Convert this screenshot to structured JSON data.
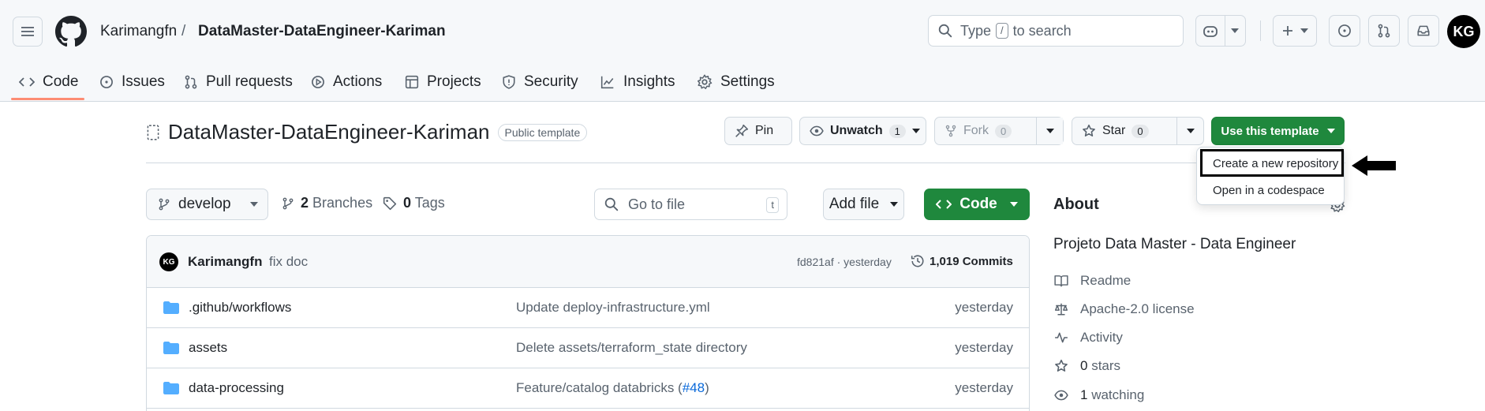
{
  "header": {
    "owner": "Karimangfn",
    "separator": "/",
    "repo": "DataMaster-DataEngineer-Kariman",
    "search_prefix": "Type",
    "search_key": "/",
    "search_suffix": "to search",
    "avatar_initials": "KG"
  },
  "nav": {
    "tabs": [
      {
        "label": "Code",
        "icon": "code-icon"
      },
      {
        "label": "Issues",
        "icon": "issue-icon"
      },
      {
        "label": "Pull requests",
        "icon": "pull-request-icon"
      },
      {
        "label": "Actions",
        "icon": "play-icon"
      },
      {
        "label": "Projects",
        "icon": "table-icon"
      },
      {
        "label": "Security",
        "icon": "shield-icon"
      },
      {
        "label": "Insights",
        "icon": "graph-icon"
      },
      {
        "label": "Settings",
        "icon": "gear-icon"
      }
    ],
    "active": "Code"
  },
  "repo_header": {
    "name": "DataMaster-DataEngineer-Kariman",
    "visibility": "Public template",
    "pin_label": "Pin",
    "watch_label": "Unwatch",
    "watch_count": "1",
    "fork_label": "Fork",
    "fork_count": "0",
    "star_label": "Star",
    "star_count": "0",
    "template_label": "Use this template"
  },
  "template_menu": {
    "items": [
      "Create a new repository",
      "Open in a codespace"
    ],
    "highlighted": "Create a new repository"
  },
  "toolbar": {
    "branch": "develop",
    "branches_count": "2",
    "branches_label": "Branches",
    "tags_count": "0",
    "tags_label": "Tags",
    "goto_placeholder": "Go to file",
    "goto_key": "t",
    "add_file_label": "Add file",
    "code_label": "Code"
  },
  "latest_commit": {
    "author": "Karimangfn",
    "avatar_initials": "KG",
    "message": "fix doc",
    "sha_time": "fd821af · yesterday",
    "commit_count": "1,019 Commits"
  },
  "files": [
    {
      "name": ".github/workflows",
      "message": "Update deploy-infrastructure.yml",
      "date": "yesterday"
    },
    {
      "name": "assets",
      "message": "Delete assets/terraform_state directory",
      "date": "yesterday"
    },
    {
      "name": "data-processing",
      "message_prefix": "Feature/catalog databricks (",
      "message_link": "#48",
      "message_suffix": ")",
      "date": "yesterday"
    }
  ],
  "about": {
    "title": "About",
    "description": "Projeto Data Master - Data Engineer",
    "readme": "Readme",
    "license": "Apache-2.0 license",
    "activity": "Activity",
    "stars_count": "0",
    "stars_label": "stars",
    "watching_count": "1",
    "watching_label": "watching"
  },
  "colors": {
    "green": "#1f883d",
    "link": "#0969da",
    "folder": "#54aeff",
    "underline": "#fd8c73"
  }
}
